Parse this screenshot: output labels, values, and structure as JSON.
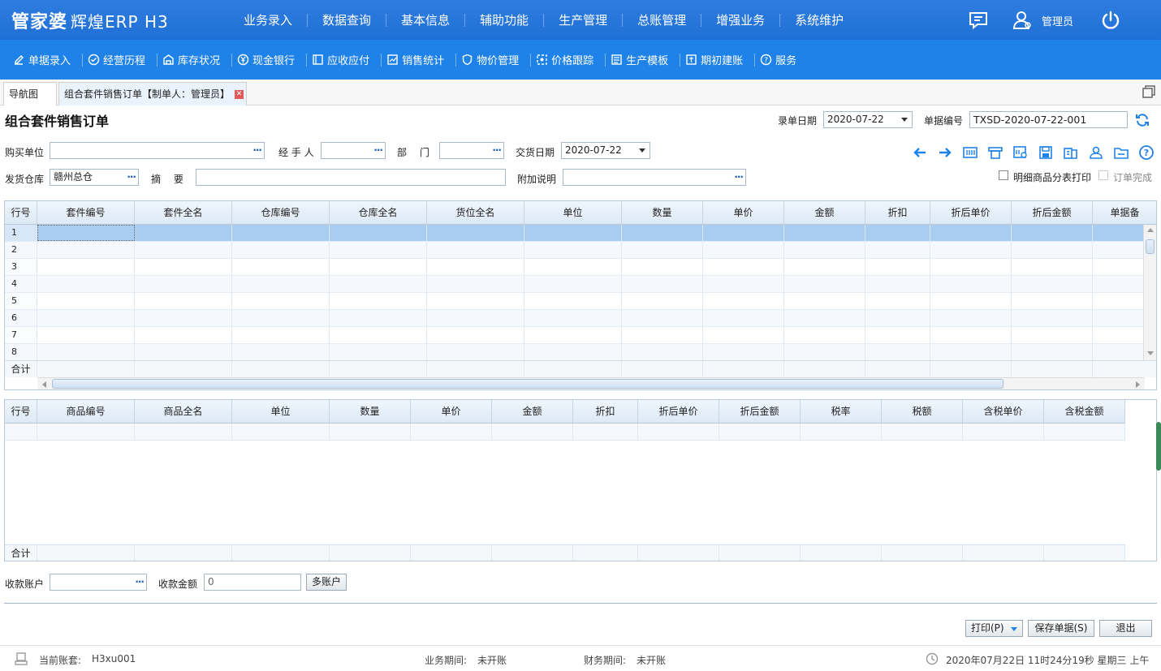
{
  "app": {
    "logo": "管家婆",
    "logo_sub": "辉煌ERP H3",
    "admin": "管理员"
  },
  "top_menu": [
    "业务录入",
    "数据查询",
    "基本信息",
    "辅助功能",
    "生产管理",
    "总账管理",
    "增强业务",
    "系统维护"
  ],
  "sub_menu": [
    {
      "label": "单据录入",
      "icon": "edit-icon"
    },
    {
      "label": "经营历程",
      "icon": "check-circle-icon"
    },
    {
      "label": "库存状况",
      "icon": "warehouse-icon"
    },
    {
      "label": "现金银行",
      "icon": "yuan-icon"
    },
    {
      "label": "应收应付",
      "icon": "ledger-icon"
    },
    {
      "label": "销售统计",
      "icon": "stats-icon"
    },
    {
      "label": "物价管理",
      "icon": "shield-icon"
    },
    {
      "label": "价格跟踪",
      "icon": "target-icon"
    },
    {
      "label": "生产模板",
      "icon": "template-icon"
    },
    {
      "label": "期初建账",
      "icon": "book-icon"
    },
    {
      "label": "服务",
      "icon": "help-icon"
    }
  ],
  "tabs": {
    "nav": "导航图",
    "active": "组合套件销售订单【制单人：管理员】"
  },
  "form": {
    "title": "组合套件销售订单",
    "entry_date_label": "录单日期",
    "entry_date": "2020-07-22",
    "doc_no_label": "单据编号",
    "doc_no": "TXSD-2020-07-22-001",
    "buyer_label": "购买单位",
    "buyer": "",
    "handler_label": "经 手 人",
    "handler": "",
    "dept_label": "部　 门",
    "dept": "",
    "delivery_date_label": "交货日期",
    "delivery_date": "2020-07-22",
    "warehouse_label": "发货仓库",
    "warehouse": "赣州总仓",
    "summary_label": "摘　 要",
    "summary": "",
    "note_label": "附加说明",
    "note": "",
    "print_detail_label": "明细商品分表打印",
    "order_done_label": "订单完成"
  },
  "grid1": {
    "columns": [
      "行号",
      "套件编号",
      "套件全名",
      "仓库编号",
      "仓库全名",
      "货位全名",
      "单位",
      "数量",
      "单价",
      "金额",
      "折扣",
      "折后单价",
      "折后金额",
      "单据备"
    ],
    "rows": [
      "1",
      "2",
      "3",
      "4",
      "5",
      "6",
      "7",
      "8"
    ],
    "sum_label": "合计"
  },
  "grid2": {
    "columns": [
      "行号",
      "商品编号",
      "商品全名",
      "单位",
      "数量",
      "单价",
      "金额",
      "折扣",
      "折后单价",
      "折后金额",
      "税率",
      "税额",
      "含税单价",
      "含税金额"
    ],
    "sum_label": "合计"
  },
  "payment": {
    "account_label": "收款账户",
    "account": "",
    "amount_label": "收款金额",
    "amount": "0",
    "multi_label": "多账户"
  },
  "buttons": {
    "print": "打印(P)",
    "save": "保存单据(S)",
    "exit": "退出"
  },
  "status": {
    "account_set_label": "当前账套:",
    "account_set": "H3xu001",
    "biz_period_label": "业务期间:",
    "biz_period": "未开账",
    "fin_period_label": "财务期间:",
    "fin_period": "未开账",
    "datetime": "2020年07月22日 11时24分19秒 星期三 上午"
  },
  "colors": {
    "topbar": "#2f7de0",
    "subbar": "#1f82e8",
    "accent": "#1f82e8",
    "selection": "#a9cdf0"
  }
}
